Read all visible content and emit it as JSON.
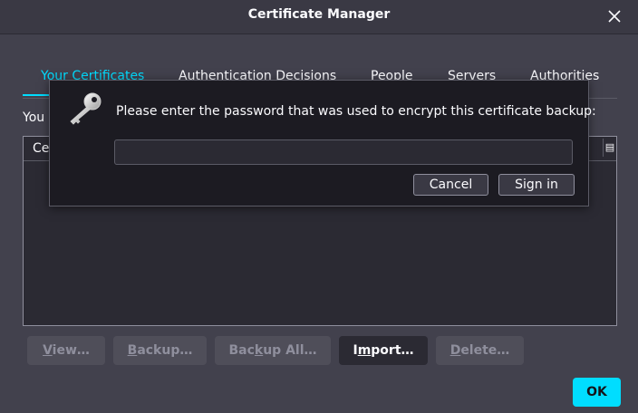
{
  "window": {
    "title": "Certificate Manager"
  },
  "tabs": [
    {
      "label": "Your Certificates",
      "active": true
    },
    {
      "label": "Authentication Decisions",
      "active": false
    },
    {
      "label": "People",
      "active": false
    },
    {
      "label": "Servers",
      "active": false
    },
    {
      "label": "Authorities",
      "active": false
    }
  ],
  "description": "You",
  "tree": {
    "column_label": "Ce"
  },
  "buttons": {
    "view": {
      "pre": "",
      "key": "V",
      "post": "iew…",
      "enabled": false
    },
    "backup": {
      "pre": "",
      "key": "B",
      "post": "ackup…",
      "enabled": false
    },
    "backup_all": {
      "pre": "Bac",
      "key": "k",
      "post": "up All…",
      "enabled": false
    },
    "import": {
      "pre": "I",
      "key": "m",
      "post": "port…",
      "enabled": true
    },
    "delete": {
      "pre": "",
      "key": "D",
      "post": "elete…",
      "enabled": false
    },
    "ok": "OK"
  },
  "dialog": {
    "prompt": "Please enter the password that was used to encrypt this certificate backup:",
    "password_value": "",
    "cancel_label": "Cancel",
    "signin_label": "Sign in",
    "icon": "key-icon"
  },
  "colors": {
    "accent": "#00ddff",
    "background": "#42414d",
    "dialog_background": "#1c1b22"
  }
}
